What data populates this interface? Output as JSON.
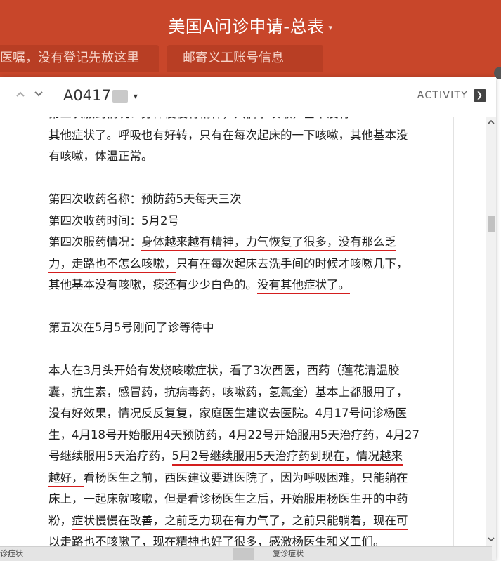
{
  "header": {
    "base_title": "美国A问诊申请-总表",
    "title_caret": "▾",
    "tabs": [
      "医嘱，没有登记先放这里",
      "邮寄义工账号信息"
    ]
  },
  "record": {
    "nav_up": "⌃",
    "nav_down": "⌄",
    "title": "A0417",
    "title_caret": "▾",
    "activity_label": "ACTIVITY",
    "activity_icon": "expand-panel-icon"
  },
  "content": {
    "p1": [
      "第三次服药情况：身体慢慢有精神，只偶尔咳嗽，基本没有",
      "其他症状了。呼吸也有好转，只有在每次起床的一下咳嗽，其他基本没",
      "有咳嗽，体温正常。"
    ],
    "p2": {
      "line1": "第四次收药名称：预防药5天每天三次",
      "line2": "第四次收药时间：5月2号",
      "line3_prefix": "第四次服药情况：",
      "line3_ul": "身体越来越有精神，力气恢复了很多，没有那么乏",
      "line4_ul": "力，走路也不怎么咳嗽，",
      "line4_rest": "只有在每次起床去洗手间的时候才咳嗽几下，",
      "line5_pre": "其他基本没有咳嗽，痰还有少少白色的。",
      "line5_ul": "没有其他症状了。"
    },
    "p3": "第五次在5月5号刚问了诊等待中",
    "p4": {
      "l1": "本人在3月头开始有发烧咳嗽症状，看了3次西医，西药（莲花清温胶",
      "l2": "囊，抗生素，感冒药，抗病毒药，咳嗽药，氢氯奎）基本上都服用了，",
      "l3": "没有好效果，情况反反复复，家庭医生建议去医院。4月17号问诊杨医",
      "l4": "生，4月18号开始服用4天预防药，4月22号开始服用5天治疗药，4月27",
      "l5_pre": "号继续服用5天治疗药，",
      "l5_ul": "5月2号继续服用5天治疗药到现在，情况越来",
      "l6_ul": "越好，",
      "l6_rest": "看杨医生之前，西医建议要进医院了，因为呼吸困难，只能躺在",
      "l7": "床上，一起床就咳嗽，但是看诊杨医生之后，开始服用杨医生开的中药",
      "l8_pre": "粉，",
      "l8_ul": "症状慢慢在改善，之前乏力现在有力气了，之前只能躺着，现在可",
      "l9_ul": "以走路也不咳嗽了，现在精神也好了很多，",
      "l9_rest": "感激杨医生和义工们。"
    }
  },
  "bottom": {
    "left_label": "诊症状",
    "right_label": "复诊症状"
  },
  "colors": {
    "header_bg": "#c8462a",
    "tab_bg": "#b83e24",
    "underline": "#d41e1e"
  }
}
